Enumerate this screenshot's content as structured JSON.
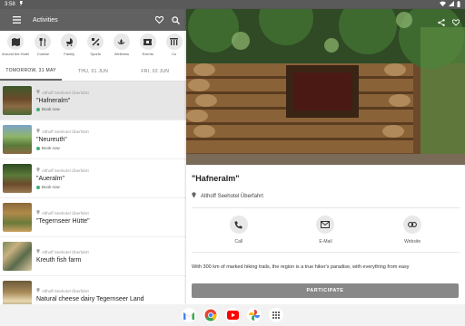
{
  "status": {
    "time": "3:58"
  },
  "appbar": {
    "title": "Activities"
  },
  "categories": [
    {
      "label": "Around the Hotel",
      "icon": "map-icon"
    },
    {
      "label": "Cuisine",
      "icon": "cutlery-icon"
    },
    {
      "label": "Family",
      "icon": "stroller-icon"
    },
    {
      "label": "Sports",
      "icon": "sports-icon"
    },
    {
      "label": "Wellness",
      "icon": "lotus-icon"
    },
    {
      "label": "Events",
      "icon": "ticket-icon"
    },
    {
      "label": "Cu",
      "icon": "columns-icon"
    }
  ],
  "dates": [
    {
      "label": "TOMORROW, 31 MAY",
      "active": true
    },
    {
      "label": "THU, 01 JUN",
      "active": false
    },
    {
      "label": "FRI, 02 JUN",
      "active": false
    }
  ],
  "activities": [
    {
      "location": "Althoff Seehotel Überfahrt",
      "name": "\"Hafneralm\"",
      "book": "Book now",
      "selected": true
    },
    {
      "location": "Althoff Seehotel Überfahrt",
      "name": "\"Neureuth\"",
      "book": "Book now",
      "selected": false
    },
    {
      "location": "Althoff Seehotel Überfahrt",
      "name": "\"Aueralm\"",
      "book": "Book now",
      "selected": false
    },
    {
      "location": "Althoff Seehotel Überfahrt",
      "name": "\"Tegernseer Hütte\"",
      "book": "",
      "selected": false
    },
    {
      "location": "Althoff Seehotel Überfahrt",
      "name": "Kreuth fish farm",
      "book": "",
      "selected": false
    },
    {
      "location": "Althoff Seehotel Überfahrt",
      "name": "Natural cheese dairy Tegernseer Land",
      "book": "",
      "selected": false
    }
  ],
  "detail": {
    "title": "\"Hafneralm\"",
    "location": "Althoff Seehotel Überfahrt",
    "actions": [
      {
        "label": "Call",
        "icon": "phone-icon"
      },
      {
        "label": "E-Mail",
        "icon": "email-icon"
      },
      {
        "label": "Website",
        "icon": "link-icon"
      }
    ],
    "description": "With 300 km of marked hiking trails, the region is a true hiker's paradise, with everything from easy",
    "participate": "PARTICIPATE"
  },
  "nav_apps": [
    "gmail-icon",
    "chrome-icon",
    "youtube-icon",
    "photos-icon",
    "apps-icon"
  ]
}
